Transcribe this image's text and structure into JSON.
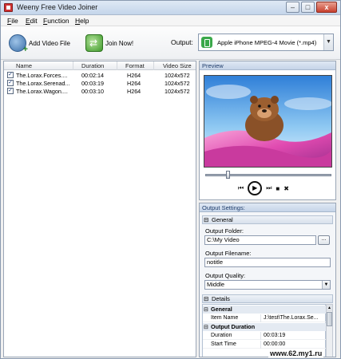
{
  "window": {
    "title": "Weeny Free Video Joiner",
    "min": "–",
    "max": "□",
    "close": "x"
  },
  "menu": [
    "File",
    "Edit",
    "Function",
    "Help"
  ],
  "toolbar": {
    "add_video_label": "Add Video File",
    "join_label": "Join Now!",
    "output_label": "Output:",
    "output_value": "Apple iPhone MPEG-4 Movie (*.mp4)"
  },
  "file_list": {
    "columns": [
      "Name",
      "Duration",
      "Format",
      "Video Size"
    ],
    "rows": [
      {
        "checked": "✓",
        "name": "The.Lorax.Forces....",
        "duration": "00:02:14",
        "format": "H264",
        "size": "1024x572"
      },
      {
        "checked": "✓",
        "name": "The.Lorax.Serenad...",
        "duration": "00:03:19",
        "format": "H264",
        "size": "1024x572"
      },
      {
        "checked": "✓",
        "name": "The.Lorax.Wagon....",
        "duration": "00:03:10",
        "format": "H264",
        "size": "1024x572"
      }
    ]
  },
  "preview": {
    "title": "Preview",
    "seek_position": 0.18,
    "controls": {
      "prev": "⏮",
      "play": "▶",
      "next": "⏭",
      "stop": "■",
      "shuffle": "✖"
    }
  },
  "settings": {
    "title": "Output Settings:",
    "general_label": "General",
    "folder_label": "Output Folder:",
    "folder_value": "C:\\My Video",
    "browse_label": "...",
    "filename_label": "Output Filename:",
    "filename_value": "notitle",
    "quality_label": "Output Quality:",
    "quality_value": "Middle",
    "details_label": "Details",
    "details": {
      "group_general": "General",
      "item_name_key": "Item Name",
      "item_name_val": "J:\\test\\The.Lorax.Se...",
      "group_duration": "Output Duration",
      "duration_key": "Duration",
      "duration_val": "00:03:19",
      "start_key": "Start Time",
      "start_val": "00:00:00"
    }
  },
  "watermark": "www.62.my1.ru"
}
